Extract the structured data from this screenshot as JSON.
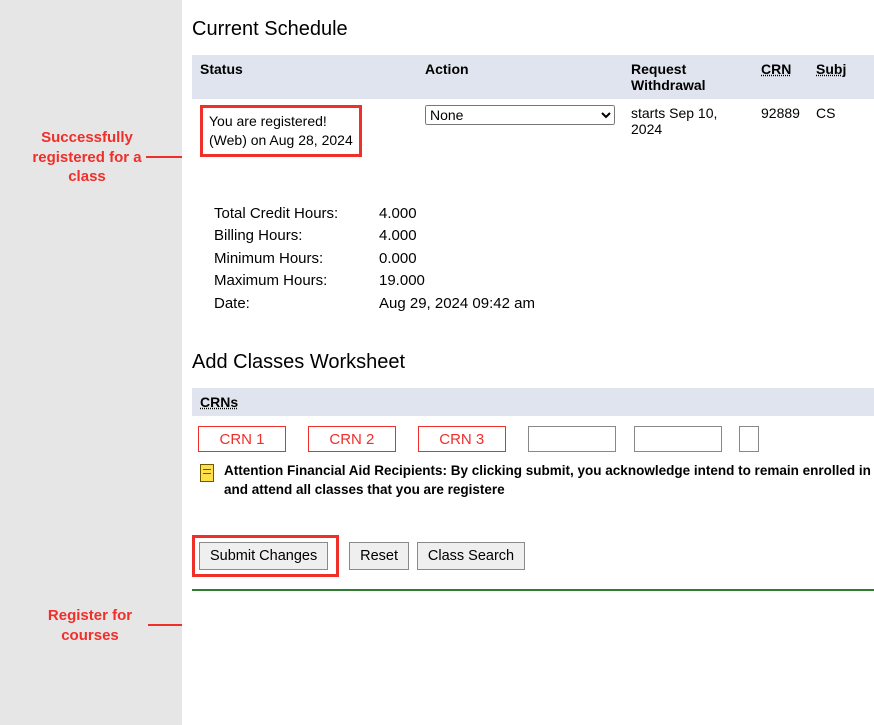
{
  "section_titles": {
    "current_schedule": "Current Schedule",
    "worksheet": "Add Classes Worksheet"
  },
  "schedule_headers": {
    "status": "Status",
    "action": "Action",
    "request_withdrawal": "Request Withdrawal",
    "crn": "CRN",
    "subj": "Subj"
  },
  "row": {
    "status_line1": "You are registered!",
    "status_line2": "(Web) on Aug 28, 2024",
    "action_selected": "None",
    "withdrawal": "starts Sep 10, 2024",
    "crn": "92889",
    "subj": "CS"
  },
  "summary": {
    "total_credit_label": "Total Credit Hours:",
    "total_credit_value": "4.000",
    "billing_label": "Billing Hours:",
    "billing_value": "4.000",
    "min_label": "Minimum Hours:",
    "min_value": "0.000",
    "max_label": "Maximum Hours:",
    "max_value": "19.000",
    "date_label": "Date:",
    "date_value": "Aug 29, 2024 09:42 am"
  },
  "crns_header": "CRNs",
  "crn_placeholders": {
    "c1": "CRN 1",
    "c2": "CRN 2",
    "c3": "CRN 3"
  },
  "notice": "Attention Financial Aid Recipients: By clicking submit, you acknowledge intend to remain enrolled in and attend all classes that you are registere",
  "buttons": {
    "submit": "Submit Changes",
    "reset": "Reset",
    "class_search": "Class Search"
  },
  "callouts": {
    "top": "Successfully registered for a class",
    "bottom": "Register for courses"
  }
}
